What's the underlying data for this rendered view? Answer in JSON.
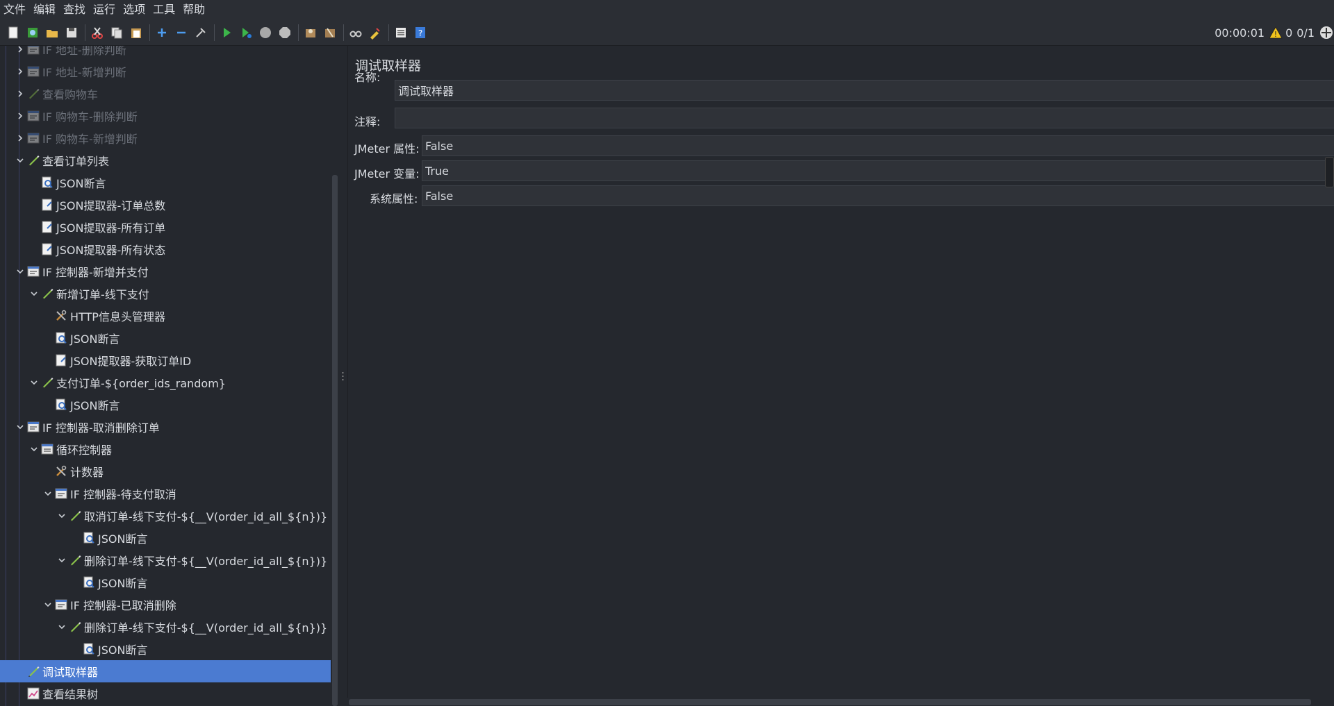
{
  "menu": [
    "文件",
    "编辑",
    "查找",
    "运行",
    "选项",
    "工具",
    "帮助"
  ],
  "toolbar": {
    "icons": [
      "new-icon",
      "templates-icon",
      "open-icon",
      "save-icon",
      "cut-icon",
      "copy-icon",
      "paste-icon",
      "expand-icon",
      "collapse-icon",
      "toggle-icon",
      "start-icon",
      "start-no-pause-icon",
      "stop-icon",
      "shutdown-icon",
      "clear-icon",
      "clear-all-icon",
      "search-icon",
      "reset-search-icon",
      "function-helper-icon",
      "help-icon"
    ],
    "elapsed_time": "00:00:01",
    "warning_count": "0",
    "threads": "0/1"
  },
  "tree": [
    {
      "label": "IF 地址-删除判断",
      "indent": 1,
      "icon": "if-controller-icon",
      "arrow": "right",
      "disabled": true
    },
    {
      "label": "IF 地址-新增判断",
      "indent": 1,
      "icon": "if-controller-icon",
      "arrow": "right",
      "disabled": true
    },
    {
      "label": "查看购物车",
      "indent": 1,
      "icon": "sampler-pen-icon",
      "arrow": "right",
      "disabled": true
    },
    {
      "label": "IF 购物车-删除判断",
      "indent": 1,
      "icon": "if-controller-icon",
      "arrow": "right",
      "disabled": true
    },
    {
      "label": "IF 购物车-新增判断",
      "indent": 1,
      "icon": "if-controller-icon",
      "arrow": "right",
      "disabled": true
    },
    {
      "label": "查看订单列表",
      "indent": 1,
      "icon": "sampler-pen-icon",
      "arrow": "down"
    },
    {
      "label": "JSON断言",
      "indent": 2,
      "icon": "assertion-icon",
      "arrow": "none"
    },
    {
      "label": "JSON提取器-订单总数",
      "indent": 2,
      "icon": "extractor-icon",
      "arrow": "none"
    },
    {
      "label": "JSON提取器-所有订单",
      "indent": 2,
      "icon": "extractor-icon",
      "arrow": "none"
    },
    {
      "label": "JSON提取器-所有状态",
      "indent": 2,
      "icon": "extractor-icon",
      "arrow": "none"
    },
    {
      "label": "IF 控制器-新增并支付",
      "indent": 1,
      "icon": "if-controller-icon",
      "arrow": "down"
    },
    {
      "label": "新增订单-线下支付",
      "indent": 2,
      "icon": "sampler-pen-icon",
      "arrow": "down"
    },
    {
      "label": "HTTP信息头管理器",
      "indent": 3,
      "icon": "config-tools-icon",
      "arrow": "none"
    },
    {
      "label": "JSON断言",
      "indent": 3,
      "icon": "assertion-icon",
      "arrow": "none"
    },
    {
      "label": "JSON提取器-获取订单ID",
      "indent": 3,
      "icon": "extractor-icon",
      "arrow": "none"
    },
    {
      "label": "支付订单-${order_ids_random}",
      "indent": 2,
      "icon": "sampler-pen-icon",
      "arrow": "down"
    },
    {
      "label": "JSON断言",
      "indent": 3,
      "icon": "assertion-icon",
      "arrow": "none"
    },
    {
      "label": "IF 控制器-取消删除订单",
      "indent": 1,
      "icon": "if-controller-icon",
      "arrow": "down"
    },
    {
      "label": "循环控制器",
      "indent": 2,
      "icon": "loop-controller-icon",
      "arrow": "down"
    },
    {
      "label": "计数器",
      "indent": 3,
      "icon": "config-tools-icon",
      "arrow": "none"
    },
    {
      "label": "IF 控制器-待支付取消",
      "indent": 3,
      "icon": "if-controller-icon",
      "arrow": "down"
    },
    {
      "label": "取消订单-线下支付-${__V(order_id_all_${n})}",
      "indent": 4,
      "icon": "sampler-pen-icon",
      "arrow": "down"
    },
    {
      "label": "JSON断言",
      "indent": 5,
      "icon": "assertion-icon",
      "arrow": "none"
    },
    {
      "label": "删除订单-线下支付-${__V(order_id_all_${n})}",
      "indent": 4,
      "icon": "sampler-pen-icon",
      "arrow": "down"
    },
    {
      "label": "JSON断言",
      "indent": 5,
      "icon": "assertion-icon",
      "arrow": "none"
    },
    {
      "label": "IF 控制器-已取消删除",
      "indent": 3,
      "icon": "if-controller-icon",
      "arrow": "down"
    },
    {
      "label": "删除订单-线下支付-${__V(order_id_all_${n})}",
      "indent": 4,
      "icon": "sampler-pen-icon",
      "arrow": "down"
    },
    {
      "label": "JSON断言",
      "indent": 5,
      "icon": "assertion-icon",
      "arrow": "none"
    },
    {
      "label": "调试取样器",
      "indent": 1,
      "icon": "sampler-pen-icon",
      "arrow": "none",
      "selected": true
    },
    {
      "label": "查看结果树",
      "indent": 1,
      "icon": "results-tree-icon",
      "arrow": "none"
    }
  ],
  "panel": {
    "title": "调试取样器",
    "name_label": "名称:",
    "name_value": "调试取样器",
    "comment_label": "注释:",
    "comment_value": "",
    "jmeter_props_label": "JMeter 属性:",
    "jmeter_props_value": "False",
    "jmeter_vars_label": "JMeter 变量:",
    "jmeter_vars_value": "True",
    "system_props_label": "系统属性:",
    "system_props_value": "False"
  }
}
